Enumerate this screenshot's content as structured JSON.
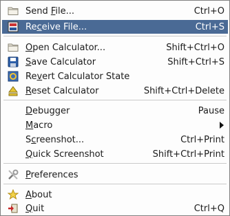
{
  "menu": {
    "items": [
      {
        "icon": "folder-icon",
        "pre": "Send ",
        "mn": "F",
        "post": "ile...",
        "accel": "Ctrl+O"
      },
      {
        "icon": "receive-file-icon",
        "pre": "Re",
        "mn": "c",
        "post": "eive File...",
        "accel": "Ctrl+S"
      },
      {
        "icon": "folder-icon",
        "pre": "",
        "mn": "O",
        "post": "pen Calculator...",
        "accel": "Shift+Ctrl+O"
      },
      {
        "icon": "floppy-disk-icon",
        "pre": "",
        "mn": "S",
        "post": "ave Calculator",
        "accel": "Shift+Ctrl+S"
      },
      {
        "icon": "revert-icon",
        "pre": "Re",
        "mn": "v",
        "post": "ert Calculator State",
        "accel": ""
      },
      {
        "icon": "eject-icon",
        "pre": "",
        "mn": "R",
        "post": "eset Calculator",
        "accel": "Shift+Ctrl+Delete"
      },
      {
        "icon": "",
        "pre": "",
        "mn": "D",
        "post": "ebugger",
        "accel": "Pause"
      },
      {
        "icon": "",
        "pre": "",
        "mn": "M",
        "post": "acro",
        "accel": ""
      },
      {
        "icon": "",
        "pre": "S",
        "mn": "c",
        "post": "reenshot...",
        "accel": "Ctrl+Print"
      },
      {
        "icon": "",
        "pre": "",
        "mn": "Q",
        "post": "uick Screenshot",
        "accel": "Shift+Ctrl+Print"
      },
      {
        "icon": "preferences-icon",
        "pre": "",
        "mn": "P",
        "post": "references",
        "accel": ""
      },
      {
        "icon": "star-icon",
        "pre": "",
        "mn": "A",
        "post": "bout",
        "accel": ""
      },
      {
        "icon": "quit-icon",
        "pre": "",
        "mn": "Q",
        "post": "uit",
        "accel": "Ctrl+Q"
      }
    ]
  },
  "colors": {
    "selected_bg": "#4a6a95",
    "menu_bg": "#fdfdfd",
    "border": "#7f7f7f"
  }
}
